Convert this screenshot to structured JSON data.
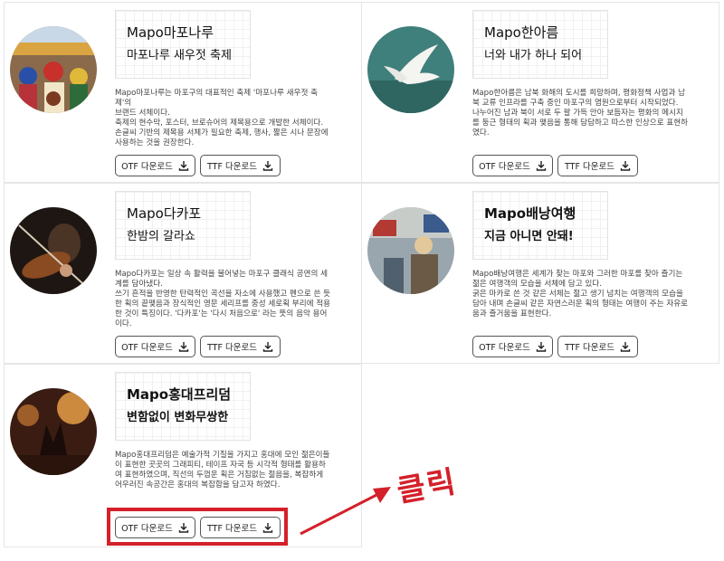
{
  "buttons": {
    "otf_label": "OTF 다운로드",
    "ttf_label": "TTF 다운로드"
  },
  "annotation": {
    "label": "클릭",
    "color": "#d4202a"
  },
  "fonts": [
    {
      "preview_line1": "Mapo마포나루",
      "preview_line2": "마포나루 새우젓 축제",
      "description": "Mapo마포나루는 마포구의 대표적인 축제 '마포나루 새우젓 축\n제'의\n브랜드 서체이다.\n축제의 현수막, 포스터, 브로슈어의 제목용으로 개발한 서체이다.\n손글씨 기반의 제목용 서체가 필요한 축제, 행사, 짧은 시나 문장에\n사용하는 것을 권장한다.",
      "image": "festival-drummers-photo"
    },
    {
      "preview_line1": "Mapo한아름",
      "preview_line2": "너와 내가 하나 되어",
      "description": "Mapo한아름은 남북 화해의 도시를 희망하며, 평화정책 사업과 남\n북 교류 인프라를 구축 중인 마포구의 염원으로부터 시작되었다.\n나누어진 남과 북이 서로 두 팔 가득 안아 보듬자는 평화의 메시지\n를 둥근 형태의 획과 맺음을 통해 담담하고 따스한 인상으로 표현하\n였다.",
      "image": "white-dove-photo"
    },
    {
      "preview_line1": "Mapo다카포",
      "preview_line2": "한밤의 갈라쇼",
      "description": "Mapo다카포는 일상 속 활력을 불어넣는 마포구 클래식 공연의 세\n계를 담아냈다.\n쓰기 흔적을 반영한 탄력적인 곡선을 자소에 사용했고 펜으로 쓴 듯\n한 획의 끝맺음과 장식적인 영문 세리프를 중성 세로획 부리에 적용\n한 것이 특징이다. '다카포'는 '다시 처음으로' 라는 뜻의 음악 용어\n이다.",
      "image": "violinist-photo"
    },
    {
      "preview_line1": "Mapo배낭여행",
      "preview_line2": "지금 아니면 안돼!",
      "description": "Mapo배낭여행은 세계가 찾는 마포와 그러한 마포를 찾아 즐기는\n젊은 여행객의 모습을 서체에 담고 있다.\n굵은 마카로 쓴 것 같은 서체는 젊고 생기 넘치는 여행객의 모습을\n담아 내며 손글씨 같은 자연스러운 획의 형태는 여행이 주는 자유로\n움과 즐거움을 표현한다.",
      "image": "backpacker-street-photo"
    },
    {
      "preview_line1": "Mapo홍대프리덤",
      "preview_line2": "변함없이 변화무쌍한",
      "description": "Mapo홍대프리덤은 예술가적 기질을 가지고 홍대에 모인 젊은이들\n이 표현한 곳곳의 그래피티, 테이프 자국 등 시각적 형태를 활용하\n여 표현하였으며, 직선의 두껍운 획은 거침없는 젊음을, 복잡하게\n어우러진 속공간은 홍대의 복잡함을 담고자 하였다.",
      "image": "concert-crowd-photo"
    }
  ]
}
